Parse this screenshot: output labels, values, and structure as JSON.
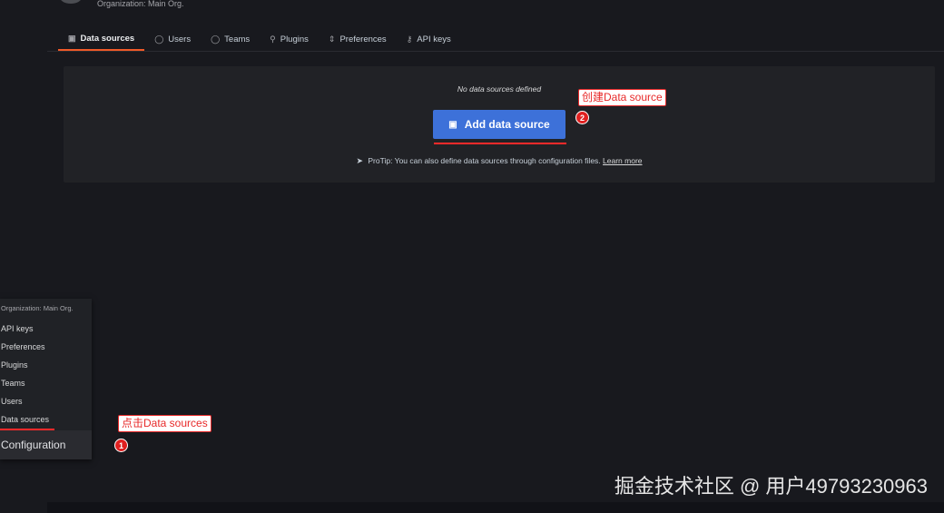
{
  "header": {
    "org_subtitle": "Organization: Main Org."
  },
  "tabs": [
    {
      "label": "Data sources",
      "icon": "database-icon",
      "active": true
    },
    {
      "label": "Users",
      "icon": "user-icon"
    },
    {
      "label": "Teams",
      "icon": "users-icon"
    },
    {
      "label": "Plugins",
      "icon": "plug-icon"
    },
    {
      "label": "Preferences",
      "icon": "sliders-icon"
    },
    {
      "label": "API keys",
      "icon": "key-icon"
    }
  ],
  "empty_state": {
    "message": "No data sources defined",
    "button_label": "Add data source",
    "protip": "ProTip: You can also define data sources through configuration files.",
    "learn_more": "Learn more"
  },
  "menu": {
    "header": "Organization: Main Org.",
    "items": [
      "API keys",
      "Preferences",
      "Plugins",
      "Teams",
      "Users",
      "Data sources"
    ],
    "footer": "Configuration"
  },
  "annotations": {
    "step1_label": "点击Data sources",
    "step1_number": "1",
    "step2_label": "创建Data source",
    "step2_number": "2",
    "color": "#e82a2a"
  },
  "colors": {
    "accent": "#3d71d9",
    "active_tab": "#f05a28"
  },
  "watermark": "掘金技术社区 @ 用户49793230963"
}
